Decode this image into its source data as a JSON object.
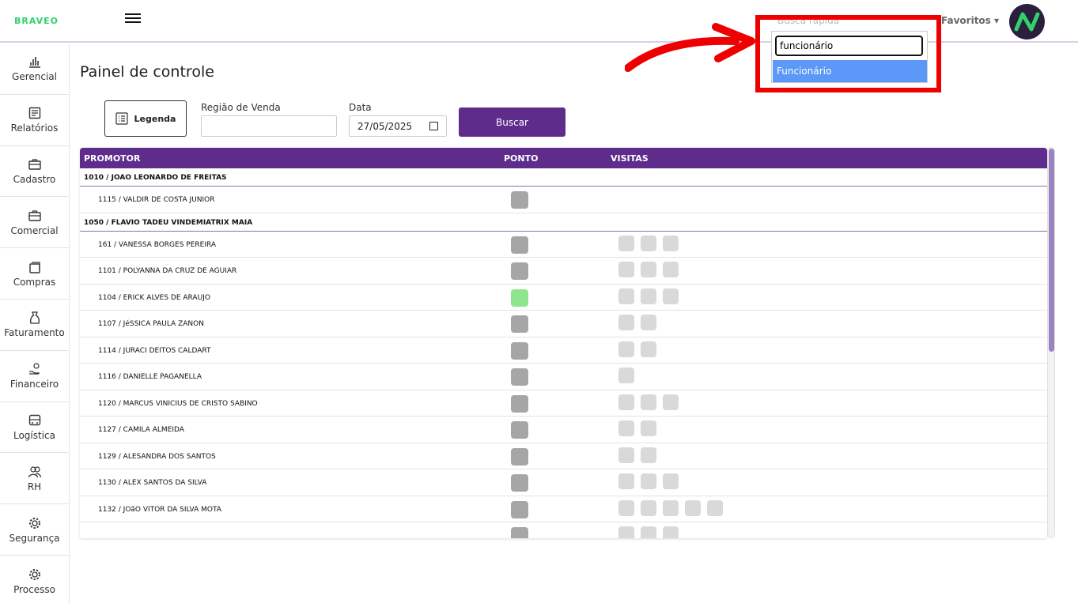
{
  "app": {
    "logo_text": "BRAVEO",
    "brand_color": "#5e2d8c",
    "accent_green": "#2fd26b"
  },
  "header": {
    "search_label": "Busca rápida",
    "favorites_label": "Favoritos ▾",
    "avatar_icon": "braveo-avatar-icon"
  },
  "quick_search": {
    "value": "funcionário",
    "option": "Funcionário"
  },
  "sidebar": {
    "items": [
      {
        "label": "Gerencial",
        "icon": "bar-chart-icon"
      },
      {
        "label": "Relatórios",
        "icon": "report-icon"
      },
      {
        "label": "Cadastro",
        "icon": "briefcase-icon"
      },
      {
        "label": "Comercial",
        "icon": "briefcase-icon"
      },
      {
        "label": "Compras",
        "icon": "cards-icon"
      },
      {
        "label": "Faturamento",
        "icon": "money-bag-icon"
      },
      {
        "label": "Financeiro",
        "icon": "hand-coins-icon"
      },
      {
        "label": "Logística",
        "icon": "bus-icon"
      },
      {
        "label": "RH",
        "icon": "people-icon"
      },
      {
        "label": "Segurança",
        "icon": "gear-icon"
      },
      {
        "label": "Processo",
        "icon": "gear-icon"
      }
    ]
  },
  "main": {
    "title": "Painel de controle",
    "legend_button": "Legenda",
    "regiao_label": "Região de Venda",
    "regiao_value": "",
    "data_label": "Data",
    "data_value": "27/05/2025",
    "search_button": "Buscar"
  },
  "table": {
    "headers": {
      "promotor": "PROMOTOR",
      "ponto": "PONTO",
      "visitas": "VISITAS"
    },
    "rows": [
      {
        "type": "group",
        "name": "1010 / JOAO LEONARDO DE FREITAS"
      },
      {
        "type": "member",
        "name": "1115 / VALDIR DE COSTA JUNIOR",
        "ponto": "gray",
        "visits": 0
      },
      {
        "type": "group",
        "name": "1050 / FLAVIO TADEU VINDEMIATRIX MAIA"
      },
      {
        "type": "member",
        "name": "161 / VANESSA BORGES PEREIRA",
        "ponto": "gray",
        "visits": 3
      },
      {
        "type": "member",
        "name": "1101 / POLYANNA DA CRUZ DE AGUIAR",
        "ponto": "gray",
        "visits": 3
      },
      {
        "type": "member",
        "name": "1104 / ERICK ALVES DE ARAUJO",
        "ponto": "green",
        "visits": 3
      },
      {
        "type": "member",
        "name": "1107 / JéSSICA PAULA ZANON",
        "ponto": "gray",
        "visits": 2
      },
      {
        "type": "member",
        "name": "1114 / JURACI DEITOS CALDART",
        "ponto": "gray",
        "visits": 2
      },
      {
        "type": "member",
        "name": "1116 / DANIELLE PAGANELLA",
        "ponto": "gray",
        "visits": 1
      },
      {
        "type": "member",
        "name": "1120 / MARCUS VINICIUS DE CRISTO SABINO",
        "ponto": "gray",
        "visits": 3
      },
      {
        "type": "member",
        "name": "1127 / CAMILA ALMEIDA",
        "ponto": "gray",
        "visits": 2
      },
      {
        "type": "member",
        "name": "1129 / ALESANDRA DOS SANTOS",
        "ponto": "gray",
        "visits": 2
      },
      {
        "type": "member",
        "name": "1130 / ALEX SANTOS DA SILVA",
        "ponto": "gray",
        "visits": 3
      },
      {
        "type": "member",
        "name": "1132 / JOãO VITOR DA SILVA MOTA",
        "ponto": "gray",
        "visits": 5
      },
      {
        "type": "member",
        "name": "",
        "ponto": "gray",
        "visits": 3
      }
    ]
  }
}
